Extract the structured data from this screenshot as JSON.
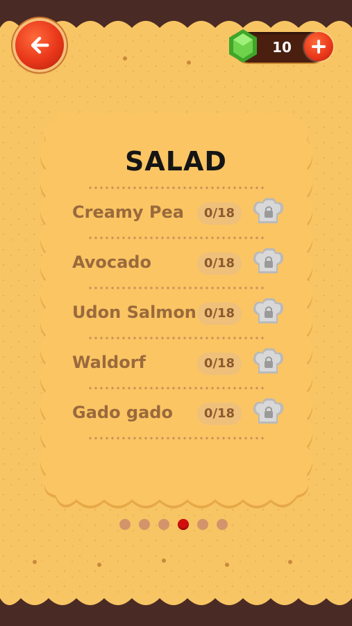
{
  "header": {
    "back_icon": "arrow-left-icon",
    "currency_icon": "green-gem-icon",
    "currency_value": "10",
    "add_icon": "plus-icon"
  },
  "category": {
    "title": "SALAD",
    "recipes": [
      {
        "name": "Creamy Pea",
        "progress": "0/18",
        "locked": true
      },
      {
        "name": "Avocado",
        "progress": "0/18",
        "locked": true
      },
      {
        "name": "Udon Salmon",
        "progress": "0/18",
        "locked": true
      },
      {
        "name": "Waldorf",
        "progress": "0/18",
        "locked": true
      },
      {
        "name": "Gado gado",
        "progress": "0/18",
        "locked": true
      }
    ]
  },
  "pager": {
    "total_pages": 6,
    "active_page": 4
  },
  "colors": {
    "biscuit": "#f7c563",
    "card": "#fbc564",
    "accent_red": "#e8361a",
    "text_brown": "#9a6a3c",
    "background": "#4a2a24"
  }
}
